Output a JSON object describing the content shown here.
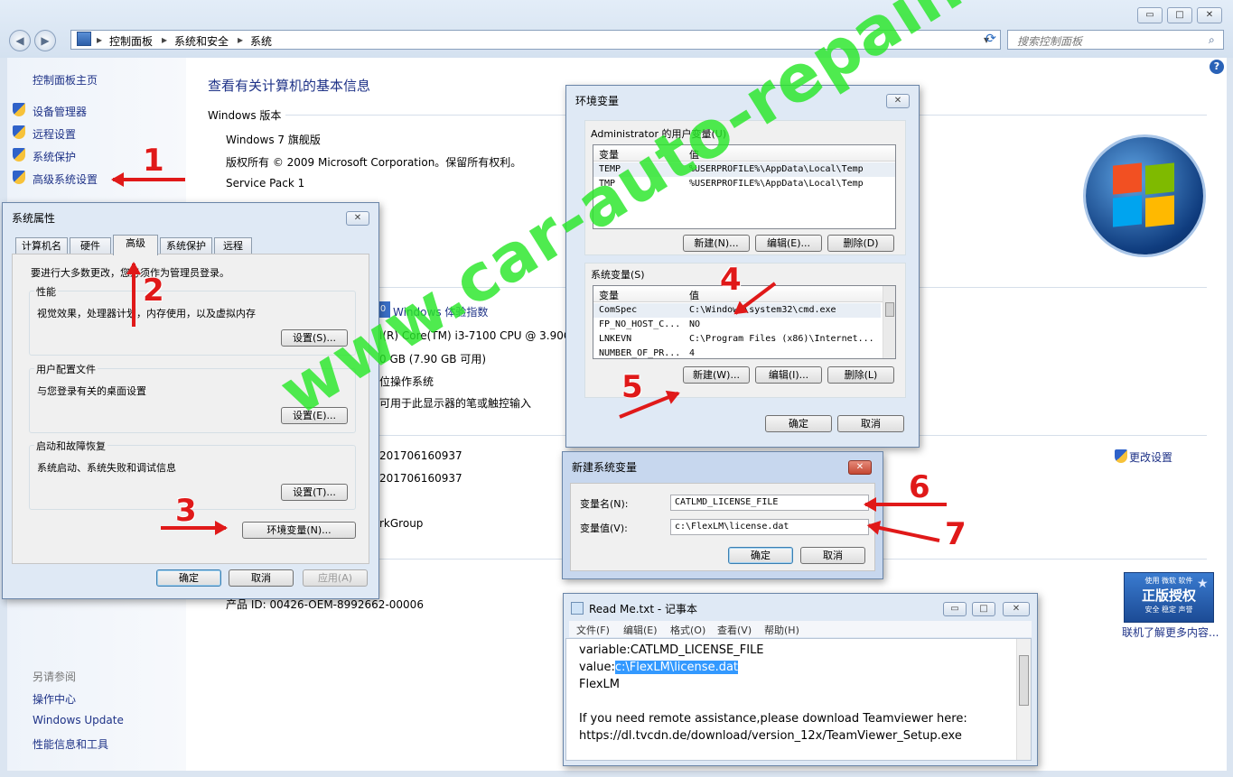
{
  "main": {
    "breadcrumb": [
      "控制面板",
      "系统和安全",
      "系统"
    ],
    "search_placeholder": "搜索控制面板",
    "window_controls": {
      "minimize": "▭",
      "maximize": "□",
      "close": "✕"
    },
    "help_icon": "?",
    "left_nav": {
      "home": "控制面板主页",
      "items": [
        "设备管理器",
        "远程设置",
        "系统保护",
        "高级系统设置"
      ],
      "see_also_title": "另请参阅",
      "see_also": [
        "操作中心",
        "Windows Update",
        "性能信息和工具"
      ]
    },
    "heading": "查看有关计算机的基本信息",
    "edition_title": "Windows 版本",
    "edition_lines": [
      "Windows 7 旗舰版",
      "版权所有 © 2009 Microsoft Corporation。保留所有权利。",
      "Service Pack 1"
    ],
    "system_fragments": {
      "rating_link": "Windows 体验指数",
      "processor": "l(R) Core(TM) i3-7100 CPU @ 3.90G",
      "memory": "0 GB (7.90 GB 可用)",
      "system_type": "位操作系统",
      "pen": "可用于此显示器的笔或触控输入",
      "computer_name": "201706160937",
      "full_name": "201706160937",
      "workgroup": "rkGroup"
    },
    "change_settings": "更改设置",
    "product_id": "产品 ID: 00426-OEM-8992662-00006",
    "genuine_badge": {
      "top": "使用 微软 软件",
      "main": "正版授权",
      "sub": "安全 稳定 声誉"
    },
    "genuine_link": "联机了解更多内容..."
  },
  "sysprops": {
    "title": "系统属性",
    "tabs": [
      "计算机名",
      "硬件",
      "高级",
      "系统保护",
      "远程"
    ],
    "admin_note": "要进行大多数更改，您必须作为管理员登录。",
    "groups": [
      {
        "title": "性能",
        "desc": "视觉效果，处理器计划，内存使用，以及虚拟内存",
        "button": "设置(S)..."
      },
      {
        "title": "用户配置文件",
        "desc": "与您登录有关的桌面设置",
        "button": "设置(E)..."
      },
      {
        "title": "启动和故障恢复",
        "desc": "系统启动、系统失败和调试信息",
        "button": "设置(T)..."
      }
    ],
    "env_button": "环境变量(N)...",
    "ok": "确定",
    "cancel": "取消",
    "apply": "应用(A)"
  },
  "envvars": {
    "title": "环境变量",
    "user_group": "Administrator 的用户变量(U)",
    "user_cols": [
      "变量",
      "值"
    ],
    "user_rows": [
      {
        "name": "TEMP",
        "value": "%USERPROFILE%\\AppData\\Local\\Temp"
      },
      {
        "name": "TMP",
        "value": "%USERPROFILE%\\AppData\\Local\\Temp"
      }
    ],
    "user_buttons": [
      "新建(N)...",
      "编辑(E)...",
      "删除(D)"
    ],
    "sys_group": "系统变量(S)",
    "sys_cols": [
      "变量",
      "值"
    ],
    "sys_rows": [
      {
        "name": "ComSpec",
        "value": "C:\\Windows\\system32\\cmd.exe"
      },
      {
        "name": "FP_NO_HOST_C...",
        "value": "NO"
      },
      {
        "name": "LNKEVN",
        "value": "C:\\Program Files (x86)\\Internet..."
      },
      {
        "name": "NUMBER_OF_PR...",
        "value": "4"
      }
    ],
    "sys_buttons": [
      "新建(W)...",
      "编辑(I)...",
      "删除(L)"
    ],
    "ok": "确定",
    "cancel": "取消"
  },
  "newvar": {
    "title": "新建系统变量",
    "name_label": "变量名(N):",
    "name_value": "CATLMD_LICENSE_FILE",
    "value_label": "变量值(V):",
    "value_value": "c:\\FlexLM\\license.dat",
    "ok": "确定",
    "cancel": "取消"
  },
  "notepad": {
    "title": "Read Me.txt - 记事本",
    "menu": [
      "文件(F)",
      "编辑(E)",
      "格式(O)",
      "查看(V)",
      "帮助(H)"
    ],
    "line1": "variable:CATLMD_LICENSE_FILE",
    "line2_prefix": "value:",
    "line2_selected": "c:\\FlexLM\\license.dat",
    "line3": "FlexLM",
    "line4": "If you need remote assistance,please download Teamviewer here:",
    "line5": "https://dl.tvcdn.de/download/version_12x/TeamViewer_Setup.exe"
  },
  "annotations": [
    "1",
    "2",
    "3",
    "4",
    "5",
    "6",
    "7"
  ],
  "watermark": "www.car-auto-repair.com"
}
